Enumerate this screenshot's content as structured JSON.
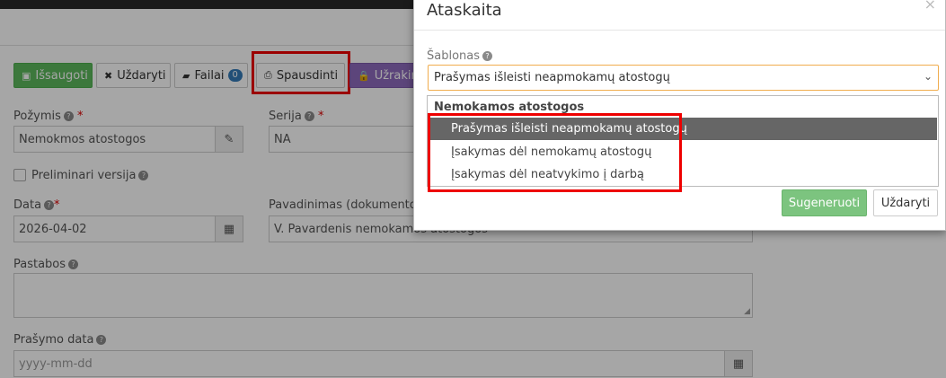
{
  "toolbar": {
    "save_label": "Išsaugoti",
    "close_label": "Uždaryti",
    "files_label": "Failai",
    "files_count": "0",
    "print_label": "Spausdinti",
    "lock_label": "Užrakint"
  },
  "form": {
    "pozymis_label": "Požymis",
    "pozymis_value": "Nemokmos atostogos",
    "serija_label": "Serija",
    "serija_value": "NA",
    "preliminari_label": "Preliminari versija",
    "data_label": "Data",
    "data_value": "2026-04-02",
    "pavadinimas_label": "Pavadinimas (dokumento a",
    "pavadinimas_value": "V. Pavardenis nemokamos atostogos",
    "pastabos_label": "Pastabos",
    "prasymo_data_label": "Prašymo data",
    "prasymo_data_placeholder": "yyyy-mm-dd"
  },
  "modal": {
    "title": "Ataskaita",
    "close_glyph": "×",
    "template_label": "Šablonas",
    "selected_template": "Prašymas išleisti neapmokamų atostogų",
    "group_label": "Nemokamos atostogos",
    "options": [
      "Prašymas išleisti neapmokamų atostogų",
      "Įsakymas dėl nemokamų atostogų",
      "Įsakymas dėl neatvykimo į darbą"
    ],
    "generate_label": "Sugeneruoti",
    "close_label": "Uždaryti"
  },
  "colors": {
    "highlight": "#ee0000",
    "save_green": "#5cb85c",
    "generate_green": "#7cc47f",
    "selected_option_bg": "#666666",
    "select_border": "#f0ad4e"
  }
}
